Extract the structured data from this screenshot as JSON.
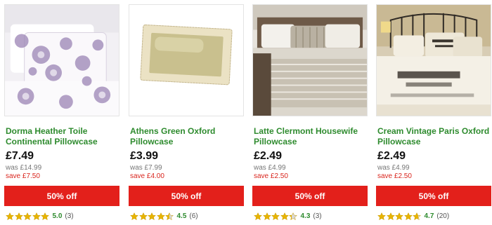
{
  "products": [
    {
      "title": "Dorma Heather Toile Continental Pillowcase",
      "price": "£7.49",
      "was": "was £14.99",
      "save": "save £7.50",
      "discount": "50% off",
      "rating": 5.0,
      "rating_text": "5.0",
      "reviews": "(3)"
    },
    {
      "title": "Athens Green Oxford Pillowcase",
      "price": "£3.99",
      "was": "was £7.99",
      "save": "save £4.00",
      "discount": "50% off",
      "rating": 4.5,
      "rating_text": "4.5",
      "reviews": "(6)"
    },
    {
      "title": "Latte Clermont Housewife Pillowcase",
      "price": "£2.49",
      "was": "was £4.99",
      "save": "save £2.50",
      "discount": "50% off",
      "rating": 4.3,
      "rating_text": "4.3",
      "reviews": "(3)"
    },
    {
      "title": "Cream Vintage Paris Oxford Pillowcase",
      "price": "£2.49",
      "was": "was £4.99",
      "save": "save £2.50",
      "discount": "50% off",
      "rating": 4.7,
      "rating_text": "4.7",
      "reviews": "(20)"
    }
  ],
  "colors": {
    "title_green": "#2e8b2e",
    "badge_red": "#e3201b",
    "save_red": "#d9251d",
    "star_gold": "#e8b400",
    "star_empty": "#d8d8d8"
  },
  "icons": {
    "star": "star-icon"
  }
}
